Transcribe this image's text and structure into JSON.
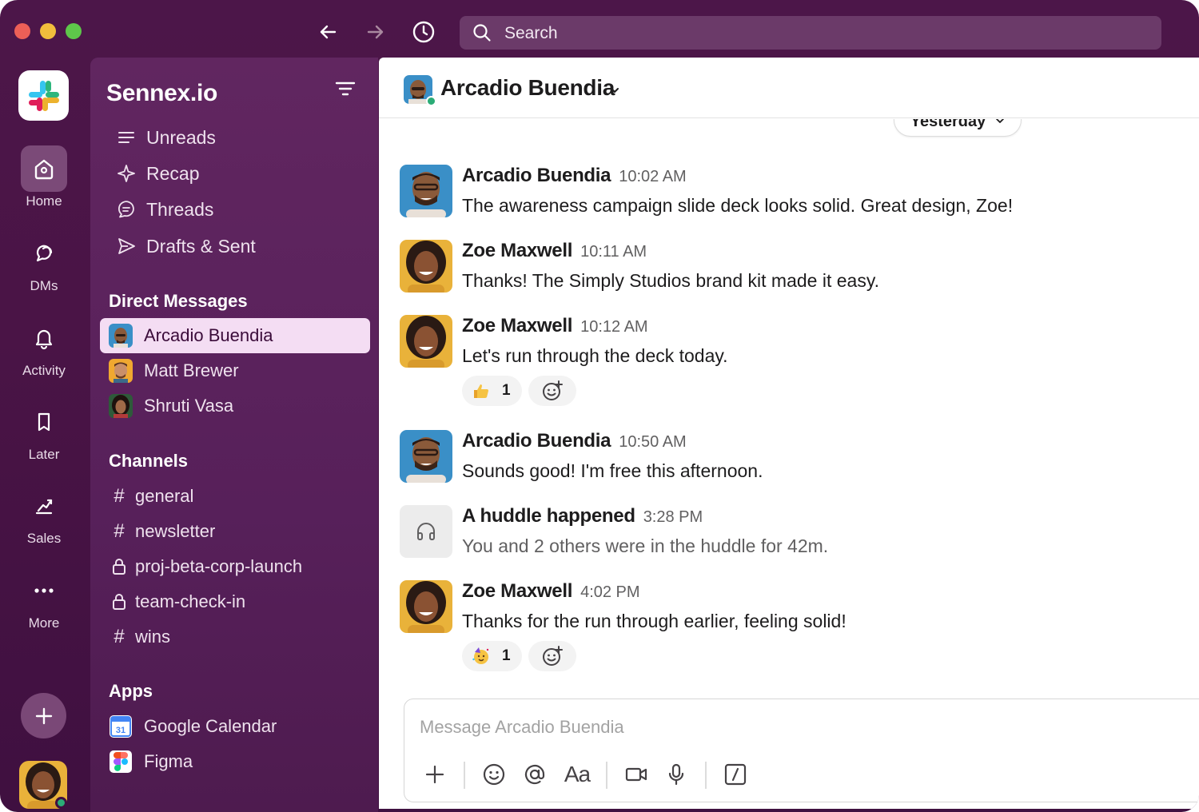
{
  "titlebar": {
    "search_label": "Search"
  },
  "rail": {
    "items": [
      {
        "label": "Home",
        "icon": "home-icon"
      },
      {
        "label": "DMs",
        "icon": "dms-icon"
      },
      {
        "label": "Activity",
        "icon": "bell-icon"
      },
      {
        "label": "Later",
        "icon": "bookmark-icon"
      },
      {
        "label": "Sales",
        "icon": "sales-icon"
      },
      {
        "label": "More",
        "icon": "more-icon"
      }
    ]
  },
  "sidebar": {
    "workspace_name": "Sennex.io",
    "nav": [
      {
        "label": "Unreads",
        "icon": "unreads-icon"
      },
      {
        "label": "Recap",
        "icon": "sparkle-icon"
      },
      {
        "label": "Threads",
        "icon": "threads-icon"
      },
      {
        "label": "Drafts & Sent",
        "icon": "send-icon"
      }
    ],
    "dm_header": "Direct Messages",
    "dms": [
      {
        "name": "Arcadio Buendia",
        "selected": true
      },
      {
        "name": "Matt Brewer",
        "selected": false
      },
      {
        "name": "Shruti Vasa",
        "selected": false
      }
    ],
    "channels_header": "Channels",
    "channels": [
      {
        "name": "general",
        "private": false
      },
      {
        "name": "newsletter",
        "private": false
      },
      {
        "name": "proj-beta-corp-launch",
        "private": true
      },
      {
        "name": "team-check-in",
        "private": true
      },
      {
        "name": "wins",
        "private": false
      }
    ],
    "apps_header": "Apps",
    "apps": [
      {
        "name": "Google Calendar",
        "icon": "google-calendar-icon",
        "badge": "31"
      },
      {
        "name": "Figma",
        "icon": "figma-icon"
      }
    ]
  },
  "conversation": {
    "title": "Arcadio Buendia",
    "date_divider": "Yesterday",
    "messages": [
      {
        "author": "Arcadio Buendia",
        "time": "10:02 AM",
        "text": "The awareness campaign slide deck looks solid. Great design, Zoe!"
      },
      {
        "author": "Zoe Maxwell",
        "time": "10:11 AM",
        "text": "Thanks! The Simply Studios brand kit made it easy."
      },
      {
        "author": "Zoe Maxwell",
        "time": "10:12 AM",
        "text": "Let's run through the deck today.",
        "reaction": {
          "emoji": "thumbs-up",
          "count": "1"
        }
      },
      {
        "author": "Arcadio Buendia",
        "time": "10:50 AM",
        "text": "Sounds good! I'm free this afternoon."
      },
      {
        "author": "A huddle happened",
        "time": "3:28 PM",
        "text": "You and 2 others were in the huddle for 42m."
      },
      {
        "author": "Zoe Maxwell",
        "time": "4:02 PM",
        "text": "Thanks for the run through earlier, feeling solid!",
        "reaction": {
          "emoji": "party-face",
          "count": "1"
        }
      }
    ]
  },
  "composer": {
    "placeholder": "Message Arcadio Buendia",
    "format_label": "Aa"
  },
  "colors": {
    "aubergine": "#4a1446",
    "sidebar": "#5b2358",
    "selected_row": "#f4ddf3",
    "online": "#2bac76"
  }
}
